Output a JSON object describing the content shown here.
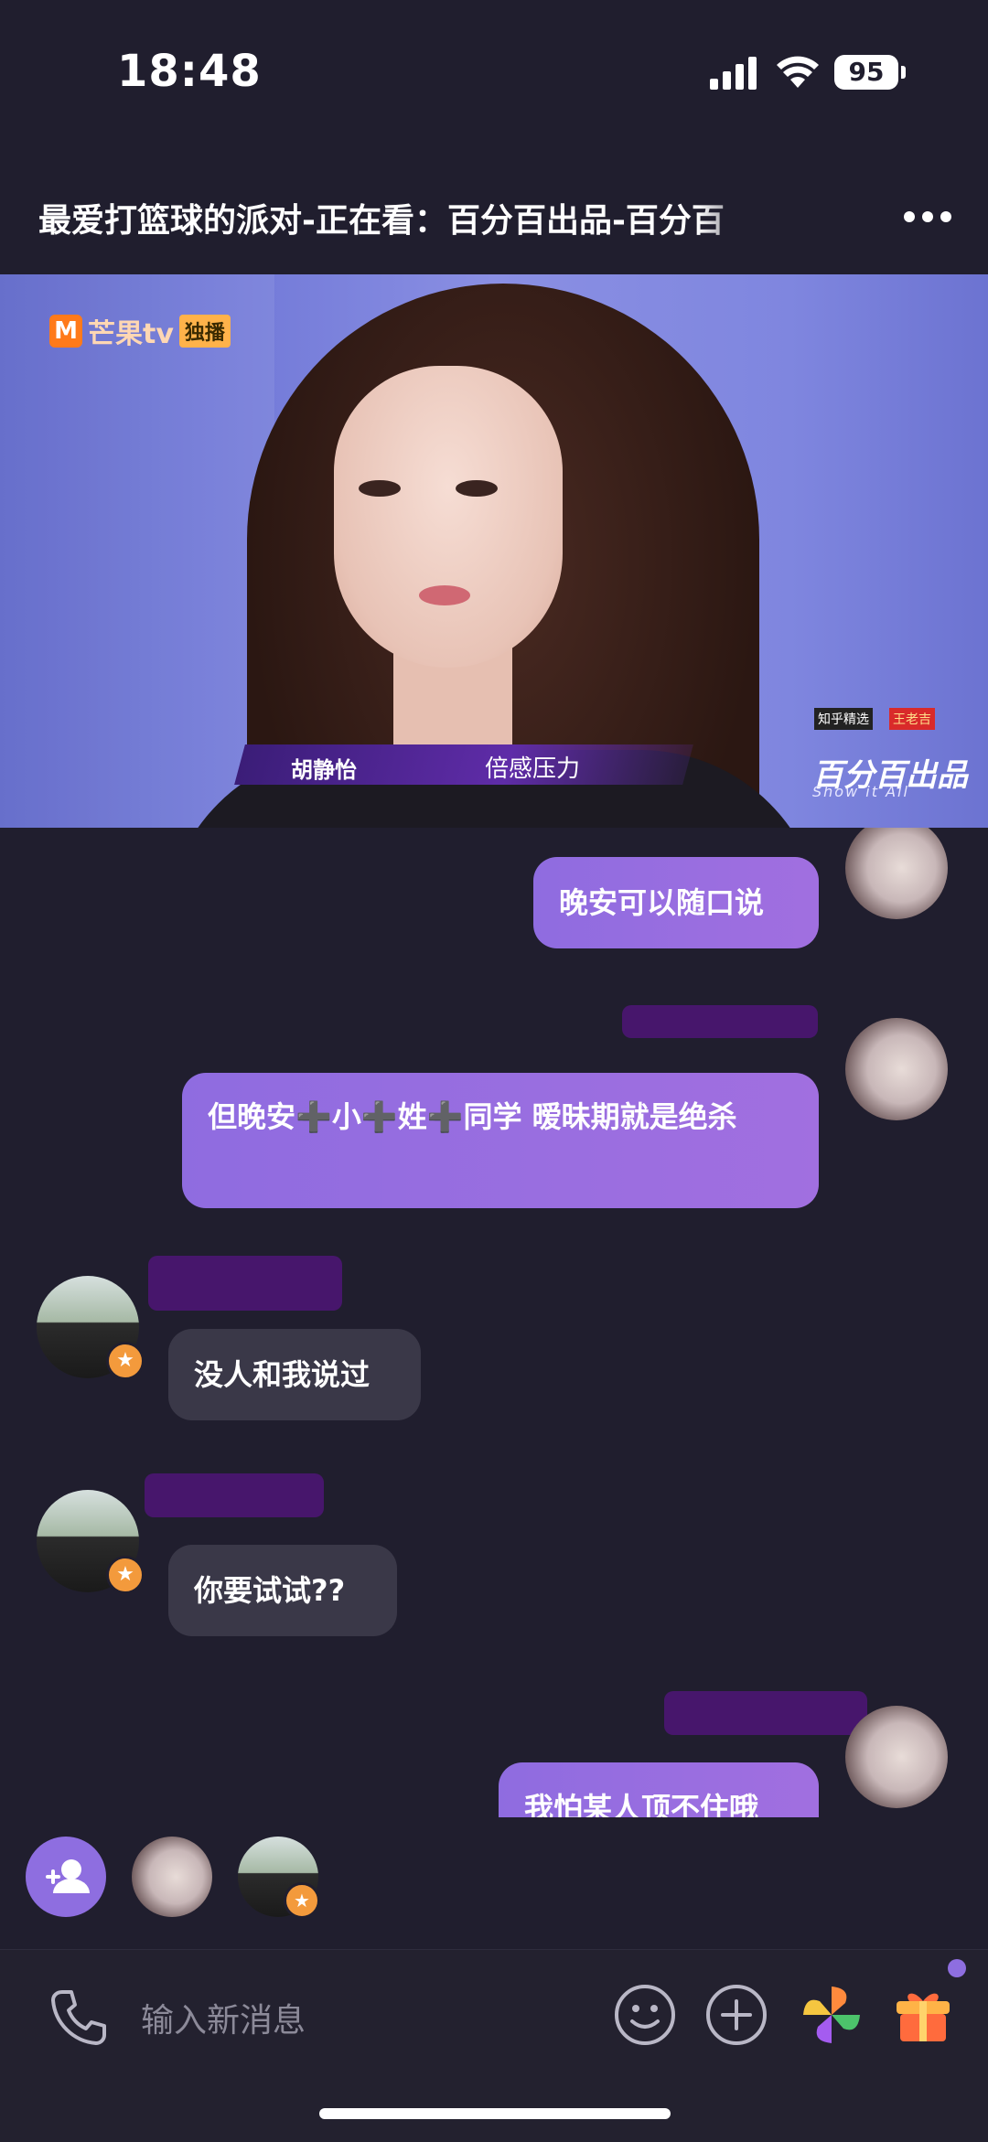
{
  "status_bar": {
    "time": "18:48",
    "battery": "95"
  },
  "header": {
    "title": "最爱打篮球的派对-正在看：百分百出品-百分百"
  },
  "video": {
    "channel_logo": "芒果tv",
    "channel_tag": "独播",
    "caption_name": "胡静怡",
    "caption_text": "倍感压力",
    "show_logo": "百分百出品",
    "show_logo_sub": "Show it All",
    "sponsor_1": "知乎精选",
    "sponsor_2": "王老吉"
  },
  "messages": [
    {
      "from": "me",
      "text": "晚安可以随口说"
    },
    {
      "from": "me",
      "text": "但晚安➕小➕姓➕同学 暧昧期就是绝杀"
    },
    {
      "from": "other",
      "text": "没人和我说过"
    },
    {
      "from": "other",
      "text": "你要试试??"
    },
    {
      "from": "me",
      "text": "我怕某人顶不住哦"
    }
  ],
  "input": {
    "placeholder": "输入新消息"
  },
  "colors": {
    "accent": "#8e6ee0",
    "background": "#201e2e",
    "bubble_other": "#3a3848"
  }
}
